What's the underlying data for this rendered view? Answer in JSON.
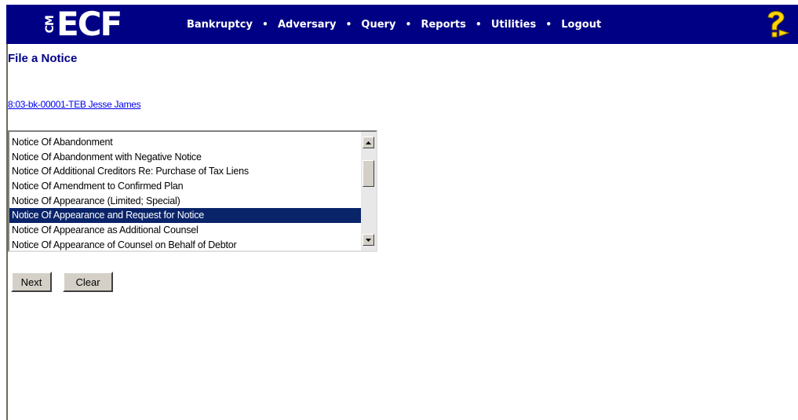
{
  "header": {
    "logo_prefix": "CM",
    "logo_text": "ECF",
    "nav": [
      {
        "label": "Bankruptcy",
        "name": "nav-bankruptcy"
      },
      {
        "label": "Adversary",
        "name": "nav-adversary"
      },
      {
        "label": "Query",
        "name": "nav-query"
      },
      {
        "label": "Reports",
        "name": "nav-reports"
      },
      {
        "label": "Utilities",
        "name": "nav-utilities"
      },
      {
        "label": "Logout",
        "name": "nav-logout"
      }
    ],
    "separator": "•",
    "help_icon": "help-question-icon",
    "bar_color": "#000084"
  },
  "page": {
    "title": "File a Notice",
    "case_link": "8:03-bk-00001-TEB Jesse James"
  },
  "event_list": {
    "items": [
      "Notice Of Abandonment",
      "Notice Of Abandonment with Negative Notice",
      "Notice Of Additional Creditors Re: Purchase of Tax Liens",
      "Notice Of Amendment to Confirmed Plan",
      "Notice Of Appearance (Limited; Special)",
      "Notice Of Appearance and Request for Notice",
      "Notice Of Appearance as Additional Counsel",
      "Notice Of Appearance of Counsel on Behalf of Debtor"
    ],
    "selected_index": 5,
    "selected_color": "#0a246a"
  },
  "buttons": {
    "next": "Next",
    "clear": "Clear"
  }
}
